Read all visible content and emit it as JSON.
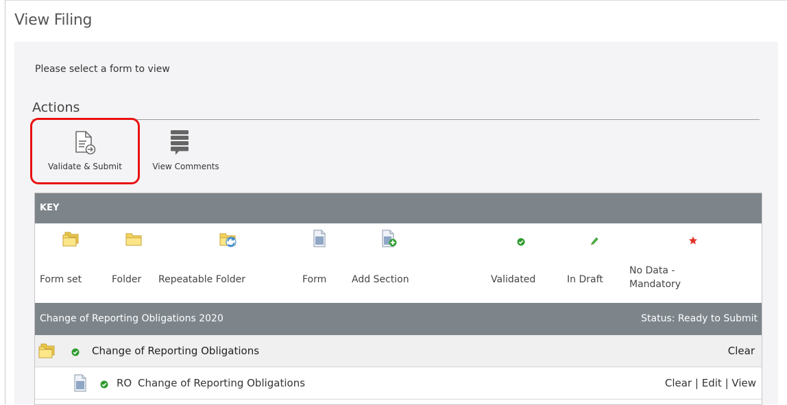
{
  "page": {
    "title": "View Filing",
    "prompt": "Please select a form to view"
  },
  "actions": {
    "heading": "Actions",
    "validate_submit_label": "Validate & Submit",
    "view_comments_label": "View Comments"
  },
  "key": {
    "header": "KEY",
    "items": [
      {
        "label": "Form set",
        "icon": "form-set-icon"
      },
      {
        "label": "Folder",
        "icon": "folder-icon"
      },
      {
        "label": "Repeatable Folder",
        "icon": "repeatable-folder-icon"
      },
      {
        "label": "Form",
        "icon": "form-icon"
      },
      {
        "label": "Add Section",
        "icon": "add-section-icon"
      },
      {
        "label": "Validated",
        "icon": "validated-icon"
      },
      {
        "label": "In Draft",
        "icon": "in-draft-icon"
      },
      {
        "label": "No Data - Mandatory",
        "icon": "no-data-mandatory-icon"
      }
    ]
  },
  "filing": {
    "title": "Change of Reporting Obligations 2020",
    "status": "Status: Ready to Submit",
    "rows": [
      {
        "type": "form-set",
        "name": "Change of Reporting Obligations",
        "actions": [
          "Clear"
        ]
      },
      {
        "type": "form",
        "code": "RO",
        "name": "Change of Reporting Obligations",
        "actions": [
          "Clear",
          "Edit",
          "View"
        ]
      }
    ]
  },
  "colors": {
    "highlight": "#e8100f",
    "header_bg": "#7d858b",
    "validated": "#2e9b2e",
    "draft": "#3aa63a",
    "mandatory": "#e0342b"
  }
}
